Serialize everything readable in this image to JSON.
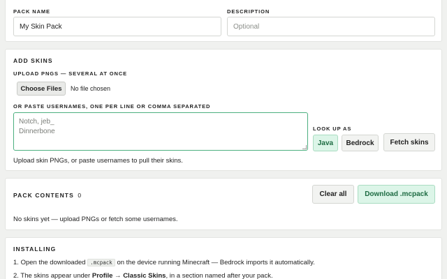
{
  "pack": {
    "name_label": "PACK NAME",
    "name_value": "My Skin Pack",
    "description_label": "DESCRIPTION",
    "description_placeholder": "Optional"
  },
  "add_skins": {
    "heading": "ADD SKINS",
    "upload_label": "UPLOAD PNGS — SEVERAL AT ONCE",
    "choose_files_label": "Choose Files",
    "no_file_text": "No file chosen",
    "paste_label": "OR PASTE USERNAMES, ONE PER LINE OR COMMA SEPARATED",
    "usernames_placeholder": "Notch, jeb_\nDinnerbone",
    "lookup_label": "LOOK UP AS",
    "java_label": "Java",
    "bedrock_label": "Bedrock",
    "fetch_label": "Fetch skins",
    "hint": "Upload skin PNGs, or paste usernames to pull their skins."
  },
  "contents": {
    "heading": "PACK CONTENTS",
    "count": "0",
    "clear_label": "Clear all",
    "download_label": "Download .mcpack",
    "empty_text": "No skins yet — upload PNGs or fetch some usernames."
  },
  "installing": {
    "heading": "INSTALLING",
    "step1_num": "1.",
    "step1_pre": "Open the downloaded",
    "step1_code": ".mcpack",
    "step1_post": "on the device running Minecraft — Bedrock imports it automatically.",
    "step2_num": "2.",
    "step2_pre": "The skins appear under",
    "step2_bold": "Profile → Classic Skins",
    "step2_post": ", in a section named after your pack."
  },
  "colors": {
    "accent_green": "#1d6b42",
    "accent_green_bg": "#dcf5e8",
    "focus_border": "#4caf7f"
  }
}
